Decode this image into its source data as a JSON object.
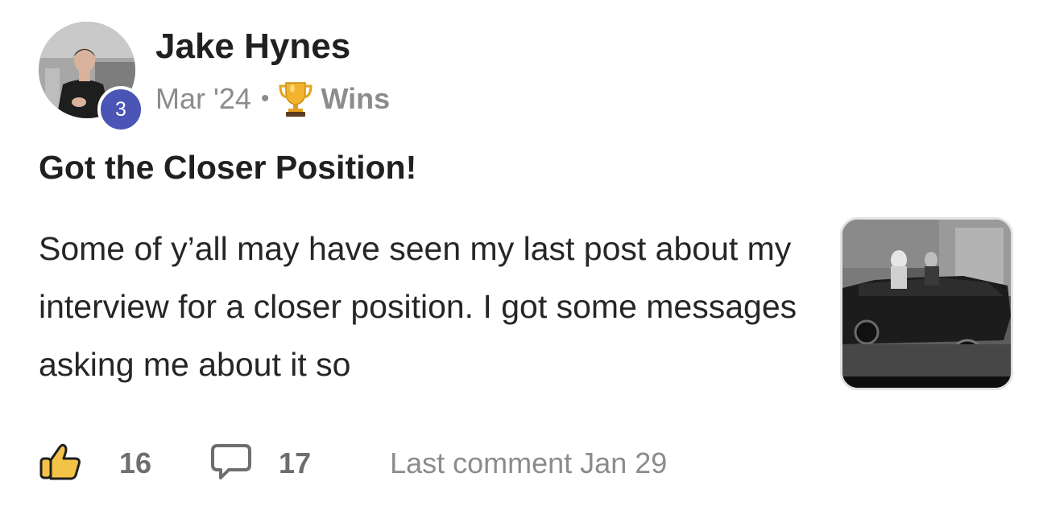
{
  "post": {
    "author": {
      "name": "Jake Hynes",
      "level": "3",
      "avatar_icon": "user-avatar-photo"
    },
    "meta": {
      "date": "Mar '24",
      "separator": "•",
      "category_icon": "trophy-icon",
      "category": "Wins"
    },
    "title": "Got the Closer Position!",
    "excerpt": "Some of y’all may have seen my last post about my interview for a closer position. I got some messages asking me about it so",
    "thumbnail_icon": "gif-thumbnail",
    "stats": {
      "like_icon": "thumbs-up-icon",
      "likes": "16",
      "comment_icon": "comment-bubble-icon",
      "comments": "17",
      "last_comment": "Last comment Jan 29"
    }
  },
  "colors": {
    "level_badge": "#4a55b5",
    "muted_text": "#8c8c8c",
    "like_icon_fill": "#f4c247"
  }
}
